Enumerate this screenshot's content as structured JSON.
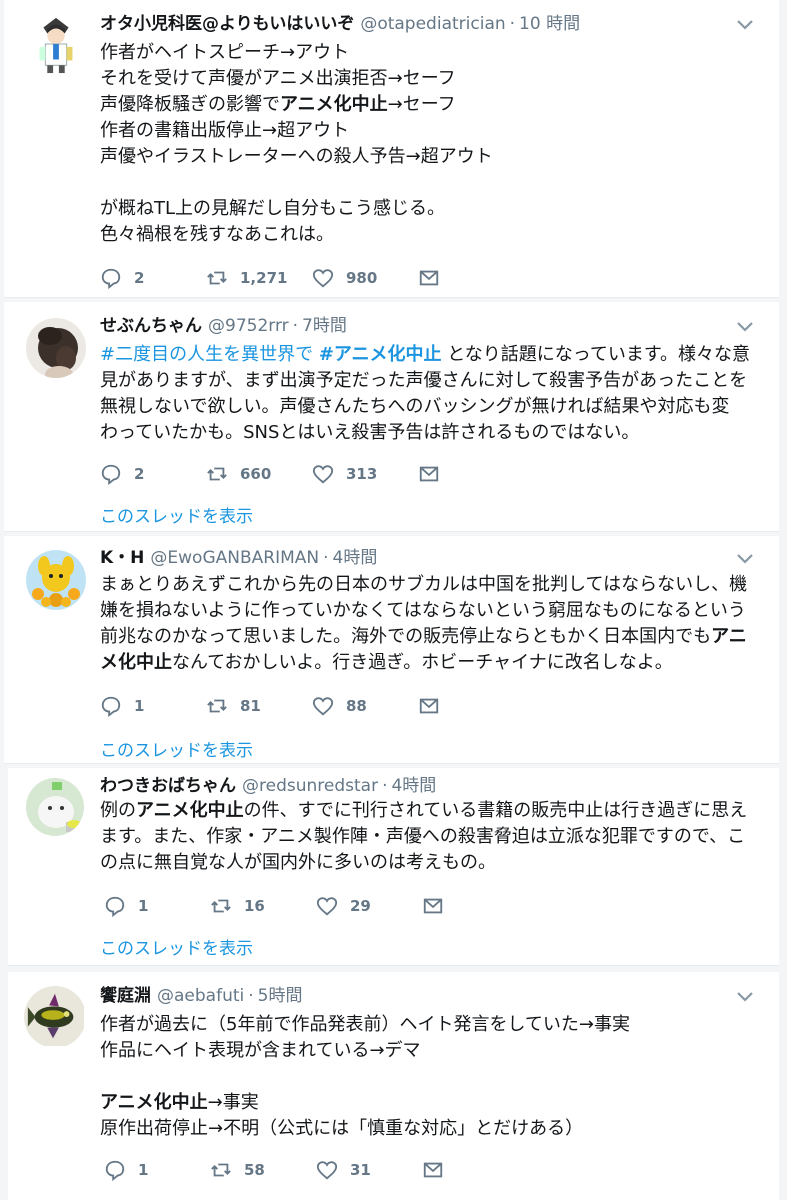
{
  "tweets": [
    {
      "name": "オタ小児科医@よりもいはいいぞ",
      "handle": "@otapediatrician",
      "time": "10 時間",
      "lines": [
        "作者がヘイトスピーチ→アウト",
        "それを受けて声優がアニメ出演拒否→セーフ",
        "声優降板騒ぎの影響で|アニメ化中止|→セーフ",
        "作者の書籍出版停止→超アウト",
        "声優やイラストレーターへの殺人予告→超アウト",
        "",
        "が概ねTL上の見解だし自分もこう感じる。",
        "色々禍根を残すなあこれは。"
      ],
      "replies": "2",
      "retweets": "1,271",
      "likes": "980"
    },
    {
      "name": "せぶんちゃん",
      "handle": "@9752rrr",
      "time": "7時間",
      "tag1": "#二度目の人生を異世界で",
      "tag2": "#アニメ化中止",
      "text1": " となり話題になっています。様々な意",
      "lines": [
        "見がありますが、まず出演予定だった声優さんに対して殺害予告があったことを",
        "無視しないで欲しい。声優さんたちへのバッシングが無ければ結果や対応も変",
        "わっていたかも。SNSとはいえ殺害予告は許されるものではない。"
      ],
      "replies": "2",
      "retweets": "660",
      "likes": "313",
      "thread": "このスレッドを表示"
    },
    {
      "name": "K・H",
      "handle": "@EwoGANBARIMAN",
      "time": "4時間",
      "lines": [
        "まぁとりあえずこれから先の日本のサブカルは中国を批判してはならないし、機",
        "嫌を損ねないように作っていかなくてはならないという窮屈なものになるという",
        "前兆なのかなって思いました。海外での販売停止ならともかく日本国内でも|アニ|",
        "|メ化中止|なんておかしいよ。行き過ぎ。ホビーチャイナに改名しなよ。"
      ],
      "replies": "1",
      "retweets": "81",
      "likes": "88",
      "thread": "このスレッドを表示"
    },
    {
      "name": "わつきおばちゃん",
      "handle": "@redsunredstar",
      "time": "4時間",
      "lines": [
        "例の|アニメ化中止|の件、すでに刊行されている書籍の販売中止は行き過ぎに思え",
        "ます。また、作家・アニメ製作陣・声優への殺害脅迫は立派な犯罪ですので、こ",
        "の点に無自覚な人が国内外に多いのは考えもの。"
      ],
      "replies": "1",
      "retweets": "16",
      "likes": "29",
      "thread": "このスレッドを表示"
    },
    {
      "name": "饗庭淵",
      "handle": "@aebafuti",
      "time": "5時間",
      "lines": [
        "作者が過去に（5年前で作品発表前）ヘイト発言をしていた→事実",
        "作品にヘイト表現が含まれている→デマ",
        "",
        "|アニメ化中止|→事実",
        "原作出荷停止→不明（公式には「慎重な対応」とだけある）"
      ],
      "replies": "1",
      "retweets": "58",
      "likes": "31"
    }
  ],
  "icons": {
    "caret": "chevron-down-icon",
    "reply": "reply-icon",
    "retweet": "retweet-icon",
    "like": "heart-icon",
    "dm": "envelope-icon"
  },
  "colors": {
    "link": "#1b95e0",
    "meta": "#657786",
    "text": "#14171a",
    "background": "#f3f5f7"
  }
}
